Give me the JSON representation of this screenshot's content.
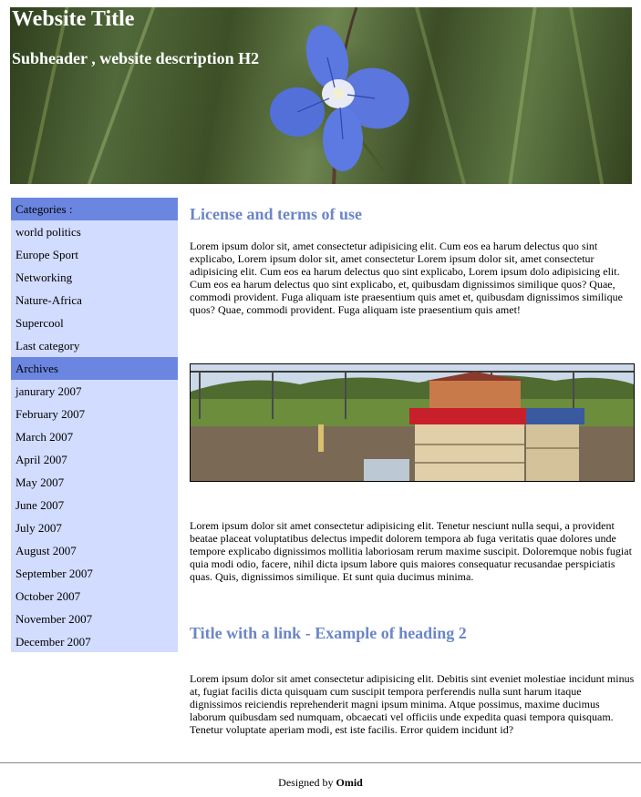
{
  "header": {
    "title": "Website Title",
    "subtitle": "Subheader , website description H2"
  },
  "sidebar": {
    "categories_label": "Categories :",
    "categories": [
      "world politics",
      "Europe Sport",
      "Networking",
      "Nature-Africa",
      "Supercool",
      "Last category"
    ],
    "archives_label": "Archives",
    "archives": [
      "janurary 2007",
      "February 2007",
      "March 2007",
      "April 2007",
      "May 2007",
      "June 2007",
      "July 2007",
      "August 2007",
      "September 2007",
      "October 2007",
      "November 2007",
      "December 2007"
    ]
  },
  "main": {
    "heading1": "License and terms of use",
    "para1": "Lorem ipsum dolor sit, amet consectetur adipisicing elit. Cum eos ea harum delectus quo sint explicabo, Lorem ipsum dolor sit, amet consectetur Lorem ipsum dolor sit, amet consectetur adipisicing elit. Cum eos ea harum delectus quo sint explicabo, Lorem ipsum dolo adipisicing elit. Cum eos ea harum delectus quo sint explicabo, et, quibusdam dignissimos similique quos? Quae, commodi provident. Fuga aliquam iste praesentium quis amet et, quibusdam dignissimos similique quos? Quae, commodi provident. Fuga aliquam iste praesentium quis amet!",
    "para2": "Lorem ipsum dolor sit amet consectetur adipisicing elit. Tenetur nesciunt nulla sequi, a provident beatae placeat voluptatibus delectus impedit dolorem tempora ab fuga veritatis quae dolores unde tempore explicabo dignissimos mollitia laboriosam rerum maxime suscipit. Doloremque nobis fugiat quia modi odio, facere, nihil dicta ipsum labore quis maiores consequatur recusandae perspiciatis quas. Quis, dignissimos similique. Et sunt quia ducimus minima.",
    "heading2": "Title with a link - Example of heading 2",
    "para3": "Lorem ipsum dolor sit amet consectetur adipisicing elit. Debitis sint eveniet molestiae incidunt minus at, fugiat facilis dicta quisquam cum suscipit tempora perferendis nulla sunt harum itaque dignissimos reiciendis reprehenderit magni ipsum minima. Atque possimus, maxime ducimus laborum quibusdam sed numquam, obcaecati vel officiis unde expedita quasi tempora quisquam. Tenetur voluptate aperiam modi, est iste facilis. Error quidem incidunt id?"
  },
  "footer": {
    "prefix": "Designed by",
    "author": "Omid"
  }
}
